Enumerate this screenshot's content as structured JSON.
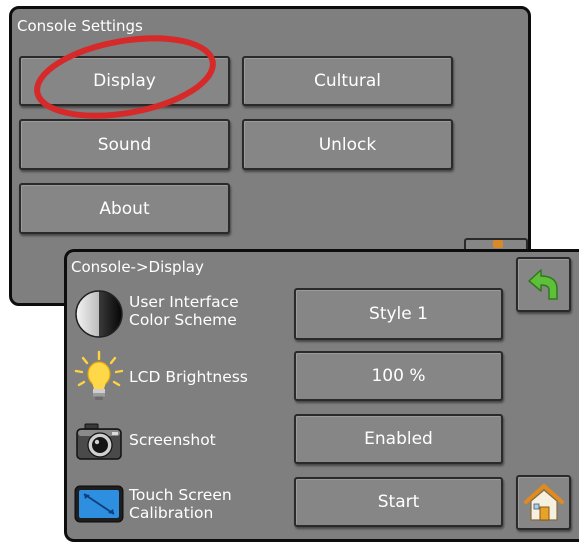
{
  "console_settings": {
    "title": "Console Settings",
    "buttons": {
      "display": "Display",
      "cultural": "Cultural",
      "sound": "Sound",
      "unlock": "Unlock",
      "about": "About"
    }
  },
  "console_display": {
    "title": "Console->Display",
    "rows": [
      {
        "label_line1": "User Interface",
        "label_line2": "Color Scheme",
        "value": "Style 1",
        "icon": "contrast-icon"
      },
      {
        "label": "LCD Brightness",
        "value": "100 %",
        "icon": "lightbulb-icon"
      },
      {
        "label": "Screenshot",
        "value": "Enabled",
        "icon": "camera-icon"
      },
      {
        "label_line1": "Touch Screen",
        "label_line2": "Calibration",
        "value": "Start",
        "icon": "touch-screen-icon"
      }
    ]
  },
  "nav": {
    "back_icon": "back-arrow-icon",
    "home_icon": "home-icon"
  },
  "colors": {
    "panel_bg": "#7f7f7f",
    "button_bg": "#868686",
    "highlight": "#d62a2a",
    "back_arrow": "#5fbf3a",
    "text": "#ffffff"
  }
}
